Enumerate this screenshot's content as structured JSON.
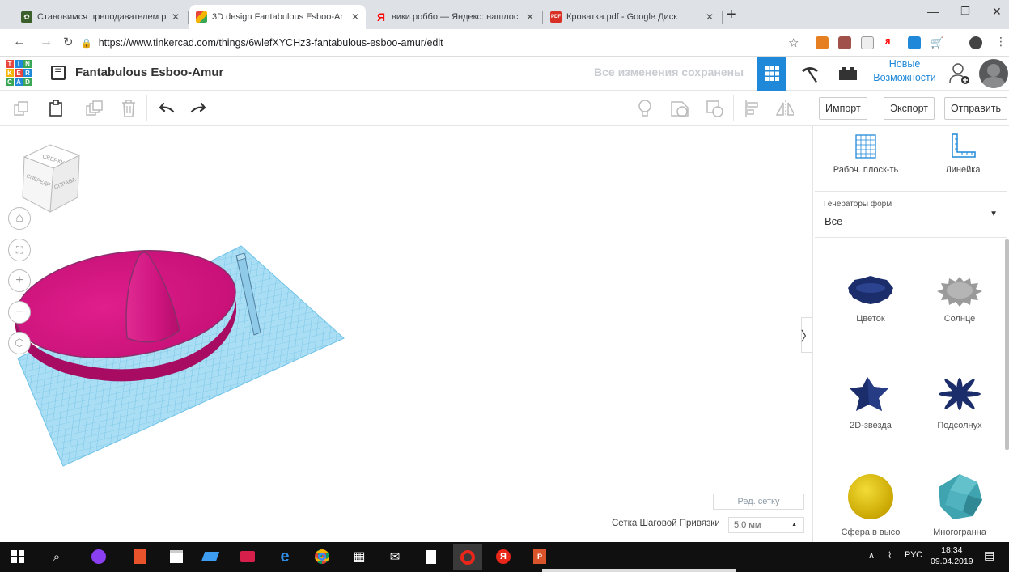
{
  "browser": {
    "tabs": [
      {
        "title": "Становимся преподавателем р",
        "active": false
      },
      {
        "title": "3D design Fantabulous Esboo-Ar",
        "active": true
      },
      {
        "title": "вики роббо — Яндекс: нашлос",
        "active": false
      },
      {
        "title": "Кроватка.pdf - Google Диск",
        "active": false
      }
    ],
    "url": "https://www.tinkercad.com/things/6wlefXYCHz3-fantabulous-esboo-amur/edit"
  },
  "app": {
    "logo_letters": [
      "T",
      "I",
      "N",
      "K",
      "E",
      "R",
      "C",
      "A",
      "D"
    ],
    "design_title": "Fantabulous Esboo-Amur",
    "save_status": "Все изменения сохранены",
    "new_features": "Новые Возможности"
  },
  "toolbar": {
    "import_label": "Импорт",
    "export_label": "Экспорт",
    "send_label": "Отправить"
  },
  "viewcube": {
    "top": "СВЕРХУ",
    "front": "СПЕРЕДИ",
    "right": "СПРАВА"
  },
  "workplane": {
    "edit_grid": "Ред. сетку",
    "snap_label": "Сетка Шаговой Привязки",
    "snap_value": "5,0 мм"
  },
  "panel": {
    "workplane_tool": "Рабоч. плоск-ть",
    "ruler_tool": "Линейка",
    "generators_label": "Генераторы форм",
    "generators_value": "Все",
    "shapes": [
      {
        "label": "Цветок"
      },
      {
        "label": "Солнце"
      },
      {
        "label": "2D-звезда"
      },
      {
        "label": "Подсолнух"
      },
      {
        "label": "Сфера в высо"
      },
      {
        "label": "Многогранна"
      }
    ]
  },
  "taskbar": {
    "lang": "РУС",
    "time": "18:34",
    "date": "09.04.2019"
  },
  "colors": {
    "accent": "#1f88d8",
    "shape_pink": "#d4157f",
    "workplane_blue": "#8fd3f0",
    "shape_navy": "#1c2d6b"
  }
}
